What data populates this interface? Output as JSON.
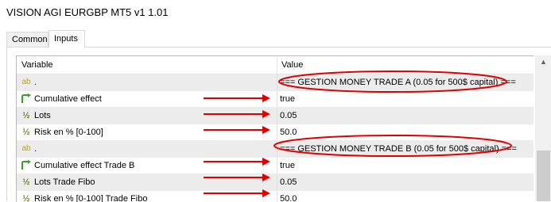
{
  "window": {
    "title": "VISION AGI EURGBP MT5 v1 1.01"
  },
  "tabs": [
    {
      "label": "Common"
    },
    {
      "label": "Inputs"
    }
  ],
  "table": {
    "headers": {
      "variable": "Variable",
      "value": "Value"
    },
    "rows": [
      {
        "icon": "ab",
        "icon_name": "text-type-icon",
        "variable": ".",
        "value": "=== GESTION MONEY TRADE A (0.05 for 500$ capital) ===",
        "grey": true
      },
      {
        "icon": "arrow",
        "icon_name": "bool-arrow-icon",
        "variable": "Cumulative effect",
        "value": "true",
        "grey": false
      },
      {
        "icon": "½",
        "icon_name": "double-type-icon",
        "variable": "Lots",
        "value": "0.05",
        "grey": true
      },
      {
        "icon": "½",
        "icon_name": "double-type-icon",
        "variable": "Risk en % [0-100]",
        "value": "50.0",
        "grey": false
      },
      {
        "icon": "ab",
        "icon_name": "text-type-icon",
        "variable": ".",
        "value": "=== GESTION MONEY TRADE B (0.05 for 500$ capital) ===",
        "grey": true
      },
      {
        "icon": "arrow",
        "icon_name": "bool-arrow-icon",
        "variable": "Cumulative effect Trade B",
        "value": "true",
        "grey": false
      },
      {
        "icon": "½",
        "icon_name": "double-type-icon",
        "variable": "Lots Trade Fibo",
        "value": "0.05",
        "grey": true
      },
      {
        "icon": "½",
        "icon_name": "double-type-icon",
        "variable": "Risk en % [0-100] Trade Fibo",
        "value": "50.0",
        "grey": false
      }
    ]
  },
  "annotations": {
    "color": "#e00000"
  },
  "colors": {
    "ab_icon": "#c8a000",
    "arrow_icon": "#3a9a2a",
    "half_icon": "#6b7d2a"
  }
}
